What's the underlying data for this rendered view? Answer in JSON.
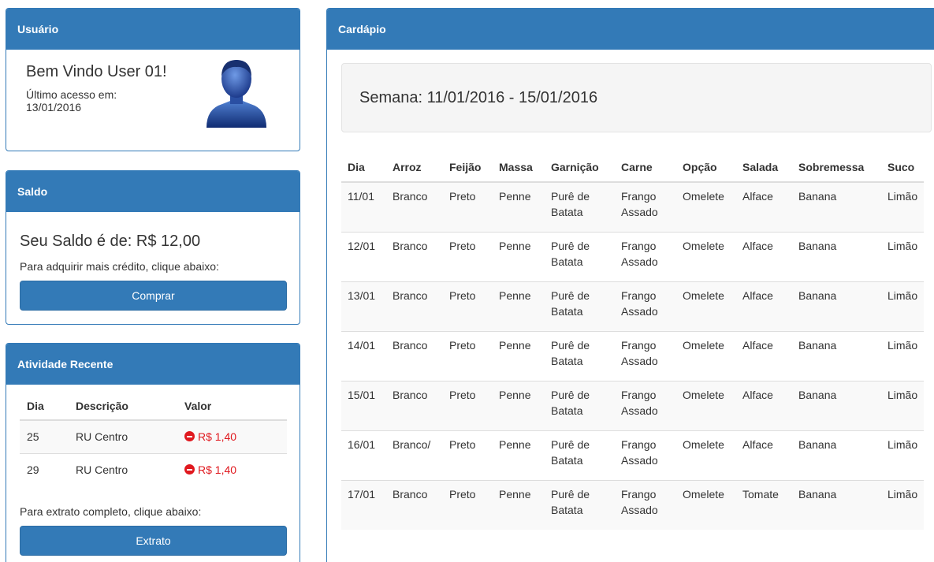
{
  "user_panel": {
    "title": "Usuário",
    "welcome": "Bem Vindo User 01!",
    "last_access_label": "Último acesso em:",
    "last_access_date": "13/01/2016"
  },
  "saldo_panel": {
    "title": "Saldo",
    "balance_text": "Seu Saldo é de: R$ 12,00",
    "hint": "Para adquirir mais crédito, clique abaixo:",
    "button": "Comprar"
  },
  "activity_panel": {
    "title": "Atividade Recente",
    "headers": [
      "Dia",
      "Descrição",
      "Valor"
    ],
    "rows": [
      {
        "dia": "25",
        "descricao": "RU Centro",
        "valor": "R$ 1,40"
      },
      {
        "dia": "29",
        "descricao": "RU Centro",
        "valor": "R$ 1,40"
      }
    ],
    "hint": "Para extrato completo, clique abaixo:",
    "button": "Extrato"
  },
  "menu_panel": {
    "title": "Cardápio",
    "week": "Semana: 11/01/2016 - 15/01/2016",
    "headers": [
      "Dia",
      "Arroz",
      "Feijão",
      "Massa",
      "Garnição",
      "Carne",
      "Opção",
      "Salada",
      "Sobremessa",
      "Suco"
    ],
    "rows": [
      {
        "dia": "11/01",
        "arroz": "Branco",
        "feijao": "Preto",
        "massa": "Penne",
        "garnicao": "Purê de Batata",
        "carne": "Frango Assado",
        "opcao": "Omelete",
        "salada": "Alface",
        "sobremesa": "Banana",
        "suco": "Limão"
      },
      {
        "dia": "12/01",
        "arroz": "Branco",
        "feijao": "Preto",
        "massa": "Penne",
        "garnicao": "Purê de Batata",
        "carne": "Frango Assado",
        "opcao": "Omelete",
        "salada": "Alface",
        "sobremesa": "Banana",
        "suco": "Limão"
      },
      {
        "dia": "13/01",
        "arroz": "Branco",
        "feijao": "Preto",
        "massa": "Penne",
        "garnicao": "Purê de Batata",
        "carne": "Frango Assado",
        "opcao": "Omelete",
        "salada": "Alface",
        "sobremesa": "Banana",
        "suco": "Limão"
      },
      {
        "dia": "14/01",
        "arroz": "Branco",
        "feijao": "Preto",
        "massa": "Penne",
        "garnicao": "Purê de Batata",
        "carne": "Frango Assado",
        "opcao": "Omelete",
        "salada": "Alface",
        "sobremesa": "Banana",
        "suco": "Limão"
      },
      {
        "dia": "15/01",
        "arroz": "Branco",
        "feijao": "Preto",
        "massa": "Penne",
        "garnicao": "Purê de Batata",
        "carne": "Frango Assado",
        "opcao": "Omelete",
        "salada": "Alface",
        "sobremesa": "Banana",
        "suco": "Limão"
      },
      {
        "dia": "16/01",
        "arroz": "Branco/",
        "feijao": "Preto",
        "massa": "Penne",
        "garnicao": "Purê de Batata",
        "carne": "Frango Assado",
        "opcao": "Omelete",
        "salada": "Alface",
        "sobremesa": "Banana",
        "suco": "Limão"
      },
      {
        "dia": "17/01",
        "arroz": "Branco",
        "feijao": "Preto",
        "massa": "Penne",
        "garnicao": "Purê de Batata",
        "carne": "Frango Assado",
        "opcao": "Omelete",
        "salada": "Tomate",
        "sobremesa": "Banana",
        "suco": "Limão"
      }
    ]
  },
  "colors": {
    "primary": "#337ab7",
    "danger": "#e0191f",
    "well": "#f5f5f5",
    "stripe": "#f9f9f9"
  },
  "icons": [
    "user-avatar-icon",
    "minus-circle-icon"
  ]
}
